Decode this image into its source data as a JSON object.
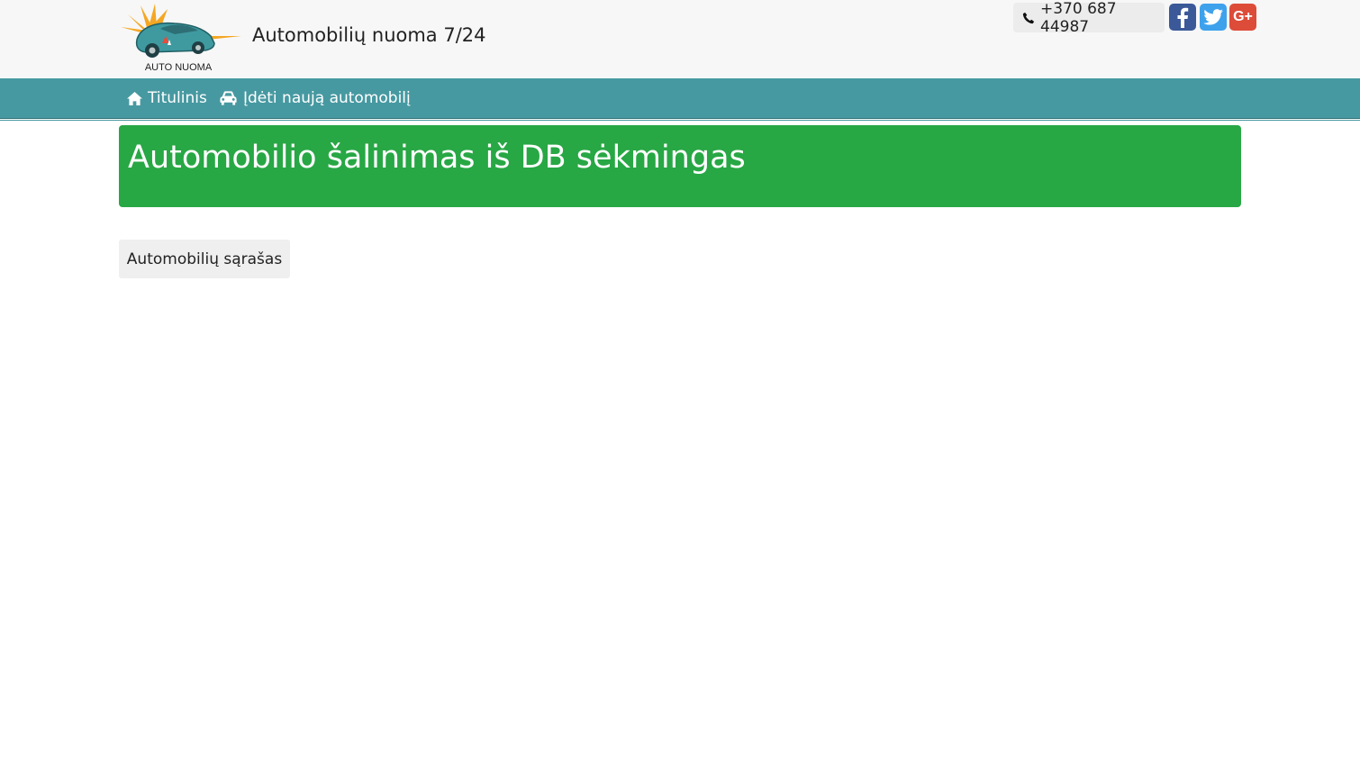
{
  "header": {
    "logo_text": "AUTO NUOMA",
    "site_title": "Automobilių nuoma 7/24",
    "phone": "+370 687 44987",
    "social": {
      "facebook_icon": "facebook-icon",
      "twitter_icon": "twitter-icon",
      "googleplus_icon": "google-plus-icon",
      "googleplus_text": "G+"
    }
  },
  "nav": {
    "items": [
      {
        "label": "Titulinis",
        "icon": "home-icon"
      },
      {
        "label": "Įdėti naują automobilį",
        "icon": "car-icon"
      }
    ]
  },
  "main": {
    "alert_message": "Automobilio šalinimas iš DB sėkmingas",
    "list_button_label": "Automobilių sąrašas"
  },
  "colors": {
    "navbar": "#4799a1",
    "alert_success": "#28a745",
    "facebook": "#3b5998",
    "twitter": "#3ea1ec",
    "googleplus": "#dd4b39"
  }
}
